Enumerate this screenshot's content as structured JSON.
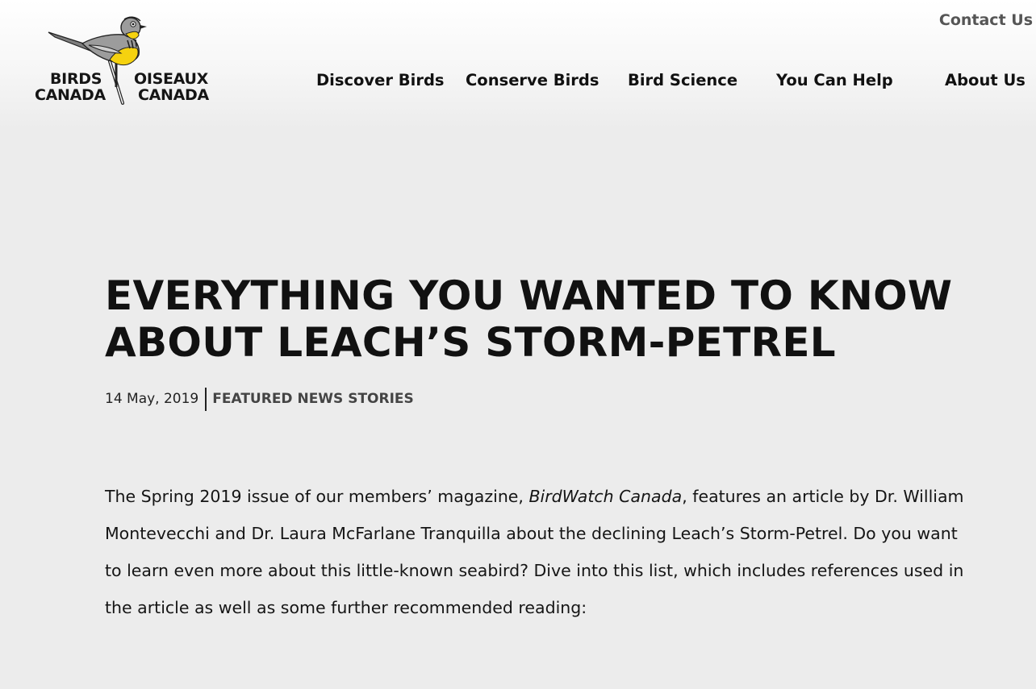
{
  "header": {
    "logo": {
      "left_word_1": "BIRDS",
      "left_word_2": "CANADA",
      "right_word_1": "OISEAUX",
      "right_word_2": "CANADA",
      "icon": "songbird-on-branch-logo"
    },
    "contact_label": "Contact Us",
    "nav": [
      {
        "label": "Discover Birds"
      },
      {
        "label": "Conserve Birds"
      },
      {
        "label": "Bird Science"
      },
      {
        "label": "You Can Help"
      },
      {
        "label": "About Us"
      }
    ]
  },
  "article": {
    "title_line_1": "EVERYTHING YOU WANTED TO KNOW",
    "title_line_2": "ABOUT LEACH’S STORM-PETREL",
    "date": "14 May, 2019",
    "category": "FEATURED NEWS STORIES",
    "intro_before": "The Spring 2019 issue of our members’ magazine, ",
    "intro_magazine": "BirdWatch Canada",
    "intro_after": ", features an article by Dr. William Montevecchi and Dr. Laura McFarlane Tranquilla about the declining Leach’s Storm-Petrel. Do you want to learn even more about this little-known seabird? Dive into this list, which includes references used in the article as well as some further recommended reading:"
  },
  "colors": {
    "page_background": "#ececec",
    "text": "#111111",
    "secondary_text": "#555555",
    "logo_yellow": "#f5d20f",
    "logo_gray": "#9c9c9c"
  }
}
